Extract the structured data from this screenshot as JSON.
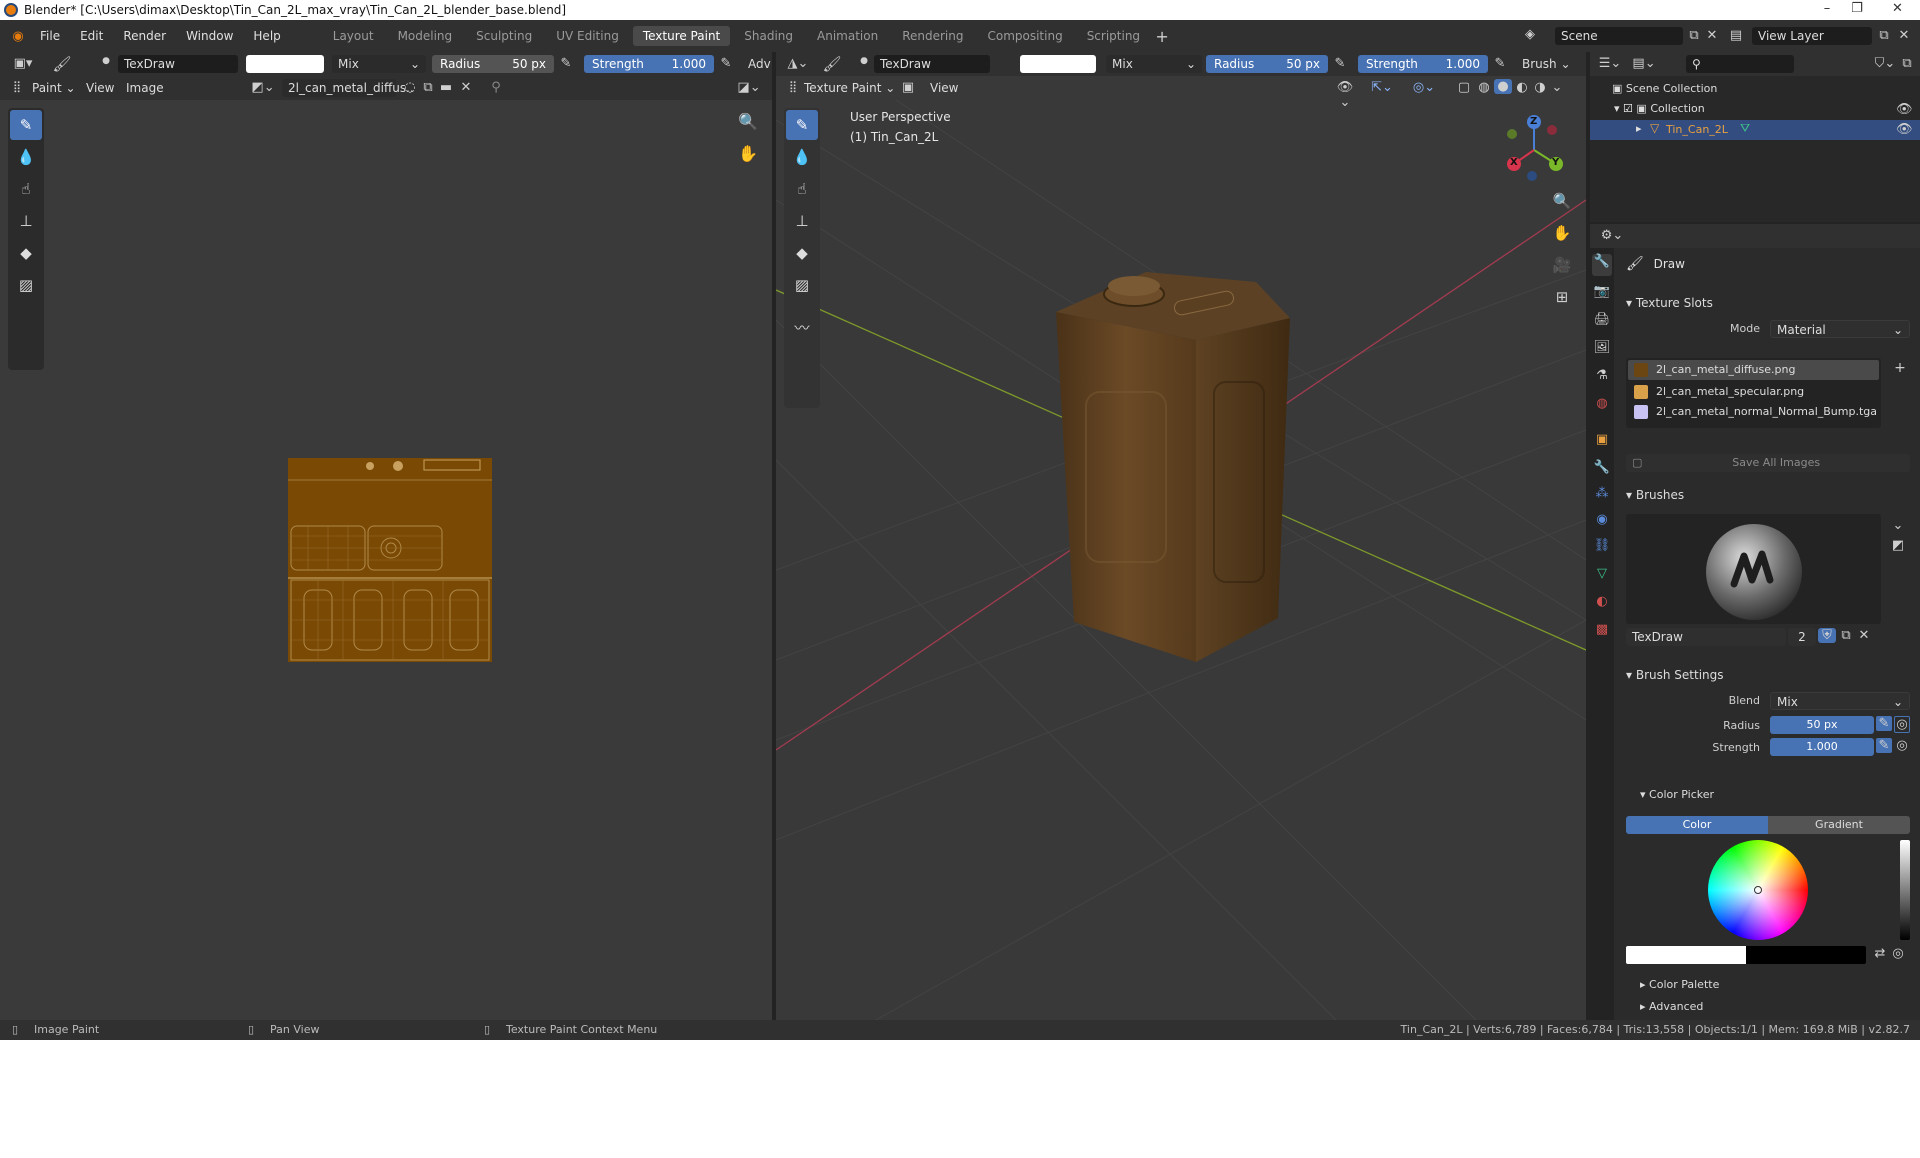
{
  "window": {
    "title": "Blender* [C:\\Users\\dimax\\Desktop\\Tin_Can_2L_max_vray\\Tin_Can_2L_blender_base.blend]"
  },
  "menus": [
    "File",
    "Edit",
    "Render",
    "Window",
    "Help"
  ],
  "workspaces": [
    {
      "label": "Layout",
      "active": false
    },
    {
      "label": "Modeling",
      "active": false
    },
    {
      "label": "Sculpting",
      "active": false
    },
    {
      "label": "UV Editing",
      "active": false
    },
    {
      "label": "Texture Paint",
      "active": true
    },
    {
      "label": "Shading",
      "active": false
    },
    {
      "label": "Animation",
      "active": false
    },
    {
      "label": "Rendering",
      "active": false
    },
    {
      "label": "Compositing",
      "active": false
    },
    {
      "label": "Scripting",
      "active": false
    }
  ],
  "scene": {
    "label": "Scene",
    "view_layer": "View Layer"
  },
  "left_tool_header": {
    "brush": "TexDraw",
    "blend": "Mix",
    "radius_label": "Radius",
    "radius_value": "50 px",
    "strength_label": "Strength",
    "strength_value": "1.000",
    "extra": "Adv"
  },
  "left_header": {
    "mode": "Paint",
    "view": "View",
    "image_menu": "Image",
    "image_name": "2l_can_metal_diffus.."
  },
  "right_tool_header": {
    "brush": "TexDraw",
    "blend": "Mix",
    "radius_label": "Radius",
    "radius_value": "50 px",
    "strength_label": "Strength",
    "strength_value": "1.000",
    "brush_menu": "Brush"
  },
  "viewport_header": {
    "mode": "Texture Paint",
    "view": "View"
  },
  "viewport": {
    "perspective": "User Perspective",
    "object": "(1) Tin_Can_2L",
    "gizmo": {
      "z": "Z",
      "y": "Y",
      "x": "X"
    }
  },
  "outliner": {
    "root": "Scene Collection",
    "collection": "Collection",
    "object": "Tin_Can_2L"
  },
  "properties": {
    "tool_name": "Draw",
    "texture_slots": {
      "title": "Texture Slots",
      "mode_label": "Mode",
      "mode_value": "Material",
      "slots": [
        {
          "name": "2l_can_metal_diffuse.png",
          "color": "#6b4512",
          "selected": true
        },
        {
          "name": "2l_can_metal_specular.png",
          "color": "#d9a24a",
          "selected": false
        },
        {
          "name": "2l_can_metal_normal_Normal_Bump.tga",
          "color": "#c7c2f2",
          "selected": false
        }
      ],
      "save_all": "Save All Images"
    },
    "brushes": {
      "title": "Brushes",
      "brush_name": "TexDraw",
      "users": "2"
    },
    "brush_settings": {
      "title": "Brush Settings",
      "blend_label": "Blend",
      "blend_value": "Mix",
      "radius_label": "Radius",
      "radius_value": "50 px",
      "strength_label": "Strength",
      "strength_value": "1.000"
    },
    "color_picker": {
      "title": "Color Picker",
      "color_tab": "Color",
      "gradient_tab": "Gradient"
    },
    "color_palette": "Color Palette",
    "advanced": "Advanced"
  },
  "status_bar": {
    "left_hint": "Image Paint",
    "middle_hint": "Pan View",
    "right_hint": "Texture Paint Context Menu",
    "stats": "Tin_Can_2L | Verts:6,789 | Faces:6,784 | Tris:13,558 | Objects:1/1 | Mem: 169.8 MiB | v2.82.7"
  },
  "colors": {
    "accent": "#4772b3",
    "can_brown": "#6b4512",
    "texture_brown": "#7a4a05"
  }
}
